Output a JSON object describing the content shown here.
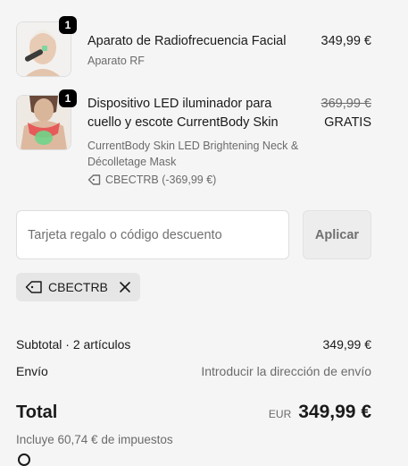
{
  "cart": {
    "items": [
      {
        "qty": "1",
        "title": "Aparato de Radiofrecuencia Facial",
        "subtitle": "Aparato RF",
        "price": "349,99 €"
      },
      {
        "qty": "1",
        "title": "Dispositivo LED iluminador para cuello y escote CurrentBody Skin",
        "subtitle": "CurrentBody Skin LED Brightening Neck & Décolletage Mask",
        "discount_label": "CBECTRB (-369,99 €)",
        "original_price": "369,99 €",
        "price": "GRATIS"
      }
    ]
  },
  "discount_form": {
    "placeholder": "Tarjeta regalo o código descuento",
    "value": "",
    "apply_label": "Aplicar"
  },
  "applied_code": {
    "label": "CBECTRB"
  },
  "summary": {
    "subtotal_label": "Subtotal · 2 artículos",
    "subtotal_value": "349,99 €",
    "shipping_label": "Envío",
    "shipping_value": "Introducir la dirección de envío",
    "total_label": "Total",
    "currency": "EUR",
    "total_value": "349,99 €",
    "tax_note": "Incluye 60,74 € de impuestos"
  },
  "colors": {
    "background": "#f5f5f5",
    "badge": "#000000",
    "muted_text": "#6b6b6b",
    "button_bg": "#ededed"
  },
  "icons": {
    "tag": "tag-icon",
    "close": "close-icon"
  }
}
